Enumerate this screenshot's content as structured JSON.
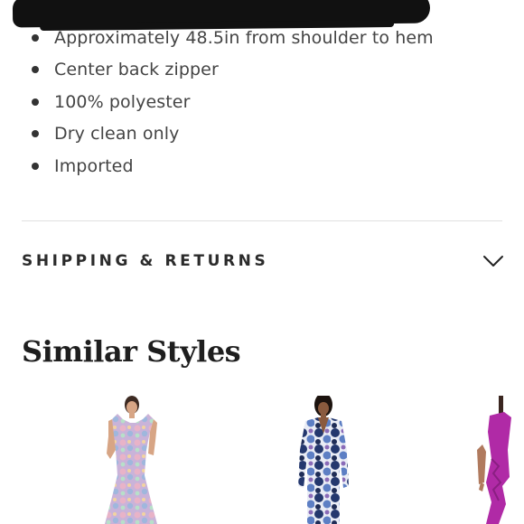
{
  "product_details": {
    "items": [
      "Approximately 48.5in from shoulder to hem",
      "Center back zipper",
      "100% polyester",
      "Dry clean only",
      "Imported"
    ]
  },
  "accordion": {
    "shipping_label": "SHIPPING & RETURNS",
    "icon": "chevron-down-icon"
  },
  "similar_styles": {
    "title": "Similar Styles",
    "products": [
      {
        "image": "floral-pastel-mermaid-gown",
        "colors": [
          "#c9a9d6",
          "#e7b9c9",
          "#9fb7dd"
        ]
      },
      {
        "image": "blue-floral-wrap-dress",
        "colors": [
          "#24386e",
          "#5d7fc4",
          "#e9ecf5"
        ]
      },
      {
        "image": "magenta-ruffle-dress",
        "colors": [
          "#b02aa6"
        ]
      }
    ]
  },
  "colors": {
    "text": "#444444",
    "heading": "#1e1e1e",
    "divider": "#e1e1e1"
  }
}
